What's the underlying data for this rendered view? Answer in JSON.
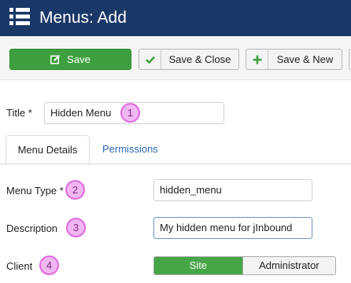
{
  "header": {
    "title": "Menus: Add",
    "icon": "list-icon"
  },
  "toolbar": {
    "save_label": "Save",
    "save_close_label": "Save & Close",
    "save_new_label": "Save & New"
  },
  "form": {
    "title_label": "Title *",
    "title_value": "Hidden Menu",
    "menu_type_label": "Menu Type *",
    "menu_type_value": "hidden_menu",
    "description_label": "Description",
    "description_value": "My hidden menu for jInbound",
    "client_label": "Client",
    "client_options": [
      "Site",
      "Administrator"
    ],
    "client_selected": "Site"
  },
  "tabs": [
    {
      "label": "Menu Details",
      "active": true
    },
    {
      "label": "Permissions",
      "active": false
    }
  ],
  "annotations": [
    "1",
    "2",
    "3",
    "4"
  ],
  "colors": {
    "header_bg": "#1a3867",
    "save_green": "#3e9f3e",
    "toggle_green": "#46a546",
    "badge_fill": "#f2b6f2",
    "badge_border": "#e06ae0",
    "link_blue": "#2a69b8"
  }
}
